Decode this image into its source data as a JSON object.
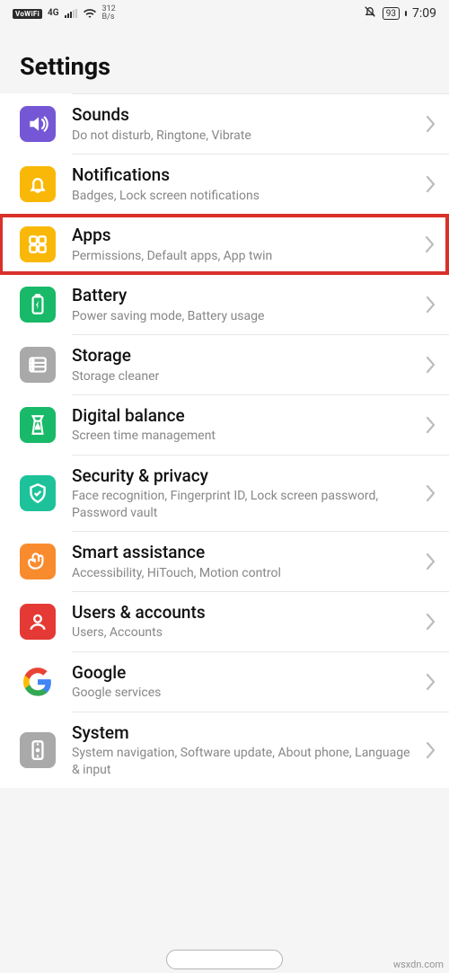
{
  "status": {
    "vowifi": "VoWiFi",
    "net": "4G",
    "speed_val": "312",
    "speed_unit": "B/s",
    "battery": "93",
    "time": "7:09"
  },
  "header": {
    "title": "Settings"
  },
  "items": [
    {
      "key": "sounds",
      "title": "Sounds",
      "sub": "Do not disturb, Ringtone, Vibrate",
      "bg": "bg-sounds"
    },
    {
      "key": "notifications",
      "title": "Notifications",
      "sub": "Badges, Lock screen notifications",
      "bg": "bg-notifications"
    },
    {
      "key": "apps",
      "title": "Apps",
      "sub": "Permissions, Default apps, App twin",
      "bg": "bg-apps",
      "highlight": true
    },
    {
      "key": "battery",
      "title": "Battery",
      "sub": "Power saving mode, Battery usage",
      "bg": "bg-battery"
    },
    {
      "key": "storage",
      "title": "Storage",
      "sub": "Storage cleaner",
      "bg": "bg-storage"
    },
    {
      "key": "digital",
      "title": "Digital balance",
      "sub": "Screen time management",
      "bg": "bg-digital"
    },
    {
      "key": "security",
      "title": "Security & privacy",
      "sub": "Face recognition, Fingerprint ID, Lock screen password, Password vault",
      "bg": "bg-security"
    },
    {
      "key": "smart",
      "title": "Smart assistance",
      "sub": "Accessibility, HiTouch, Motion control",
      "bg": "bg-smart"
    },
    {
      "key": "users",
      "title": "Users & accounts",
      "sub": "Users, Accounts",
      "bg": "bg-users"
    },
    {
      "key": "google",
      "title": "Google",
      "sub": "Google services",
      "bg": "bg-google"
    },
    {
      "key": "system",
      "title": "System",
      "sub": "System navigation, Software update, About phone, Language & input",
      "bg": "bg-system"
    }
  ],
  "watermark": "wsxdn.com"
}
